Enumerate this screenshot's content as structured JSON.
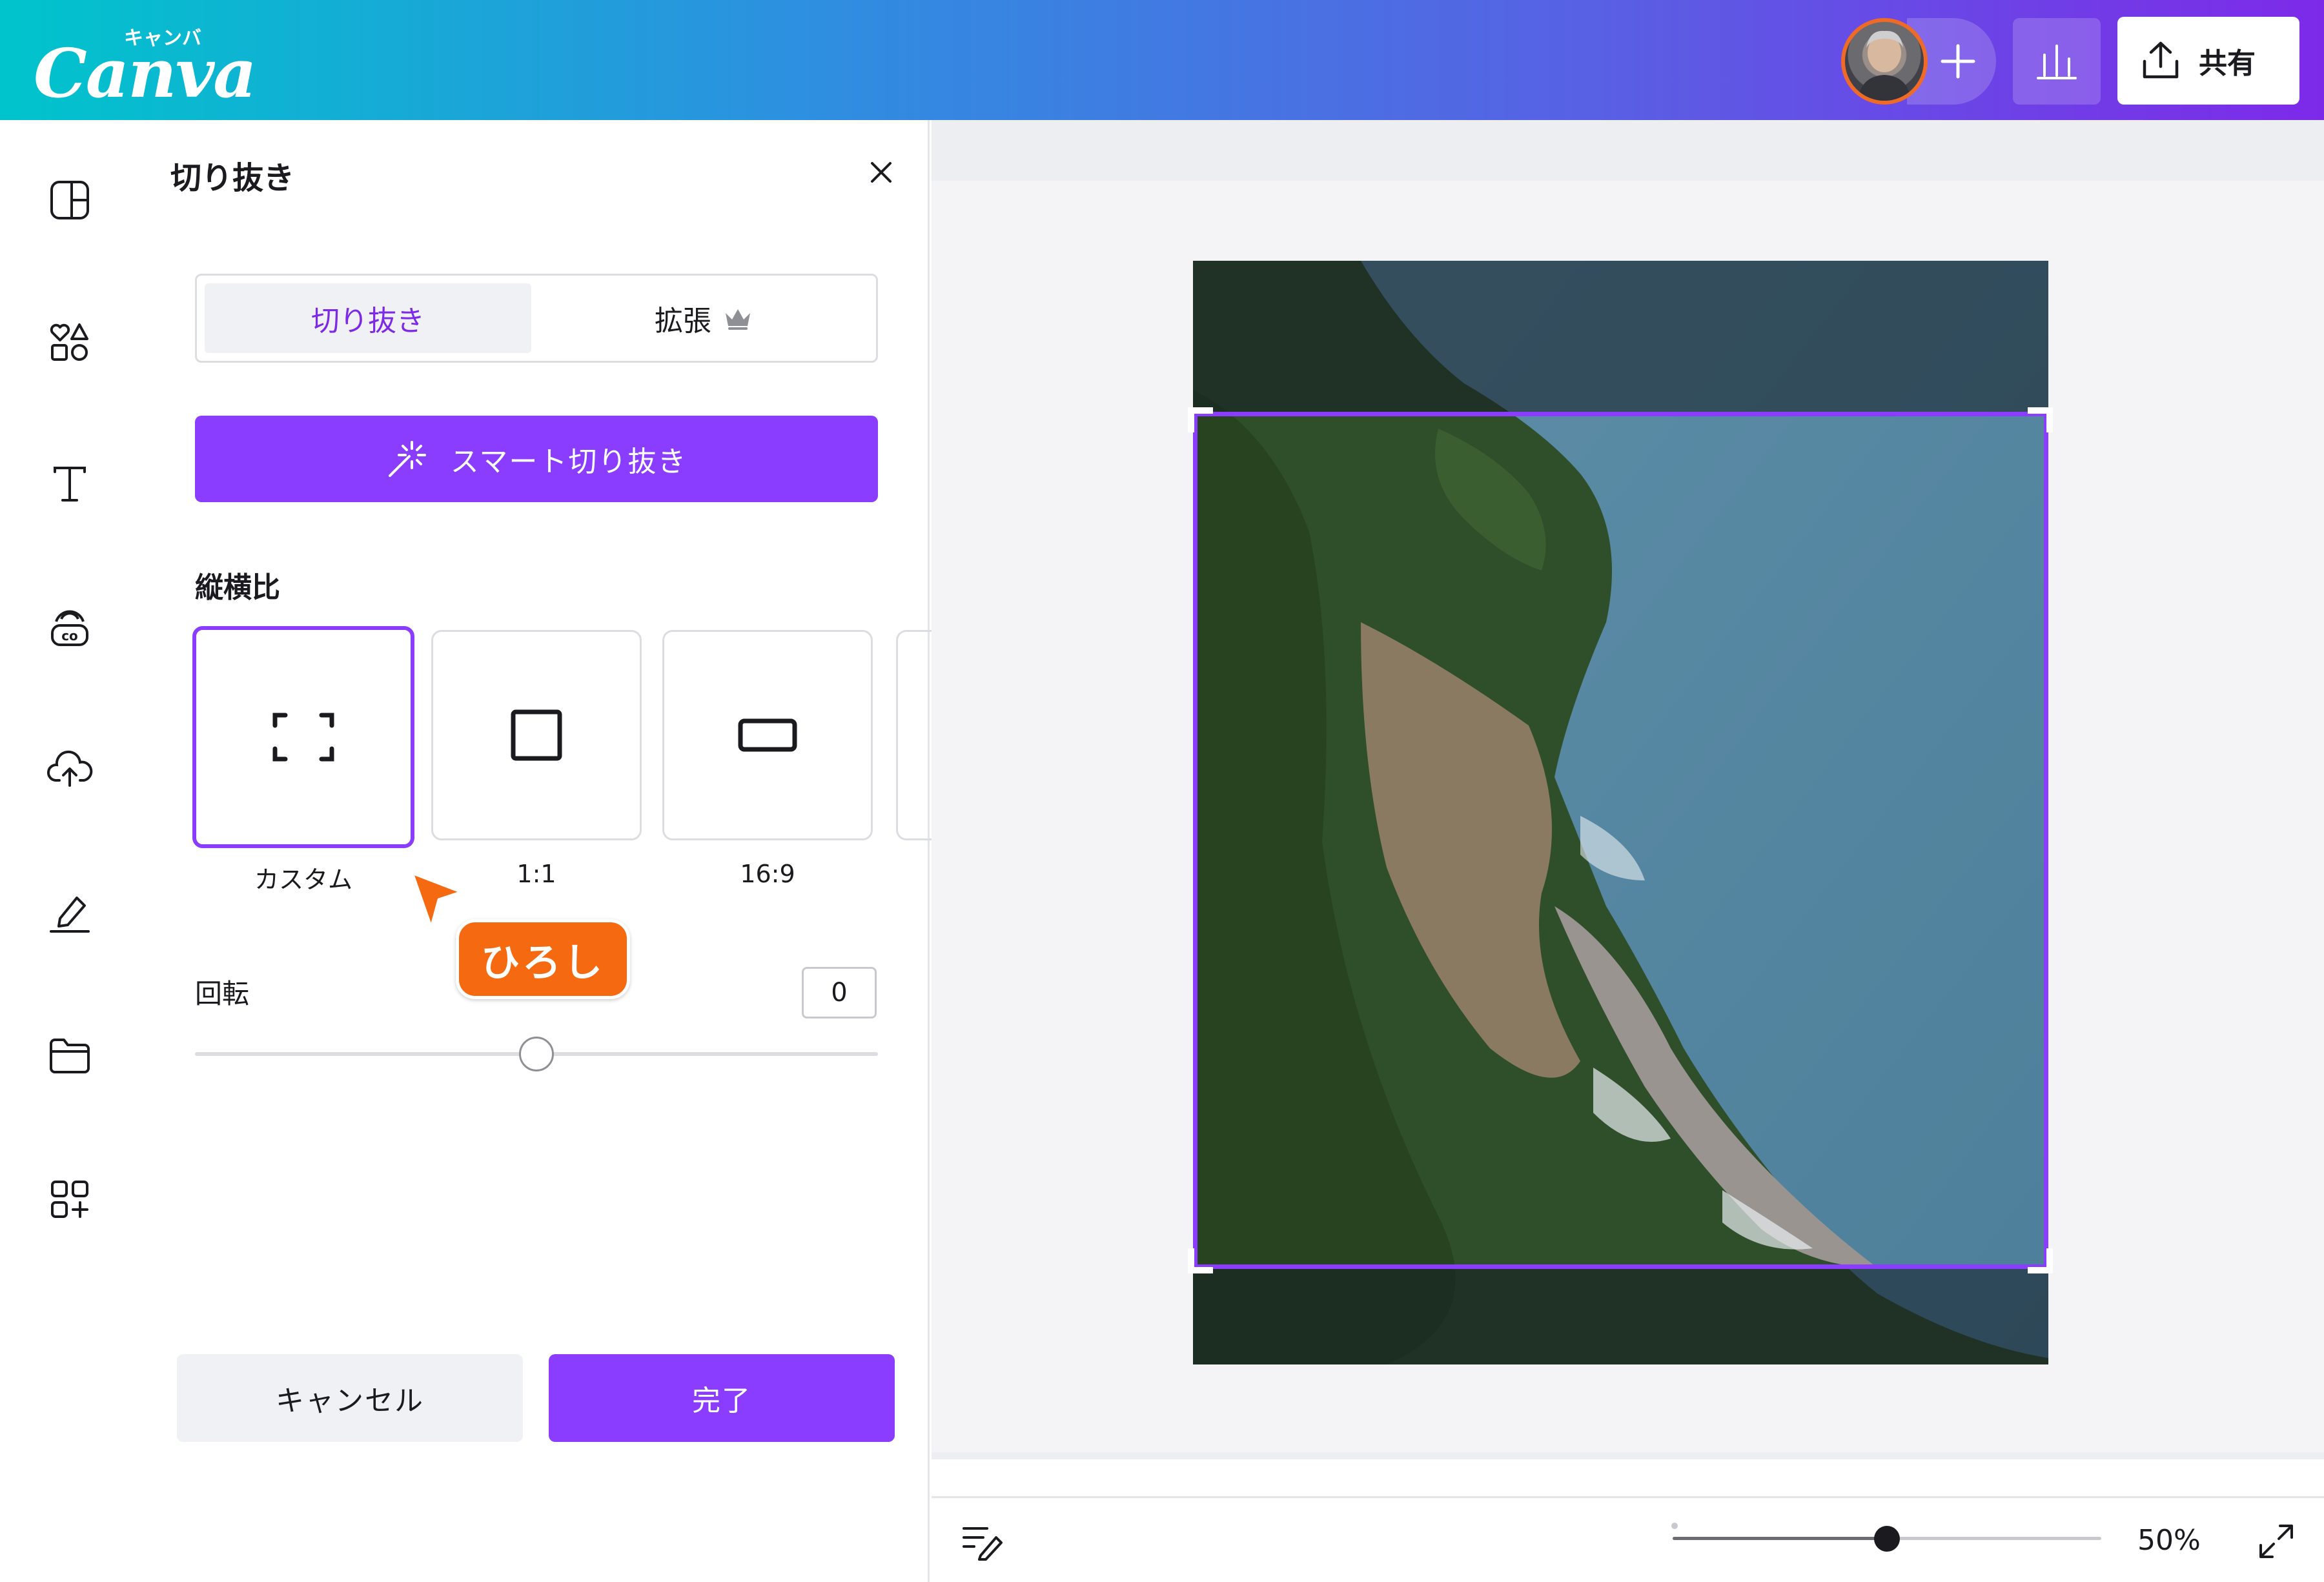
{
  "header": {
    "logo_kana": "キャンバ",
    "logo_word": "Canva",
    "share_label": "共有"
  },
  "panel": {
    "title": "切り抜き",
    "tabs": {
      "crop": "切り抜き",
      "expand": "拡張"
    },
    "smart_crop_label": "スマート切り抜き",
    "aspect_ratio_title": "縦横比",
    "ratios": [
      {
        "label": "カスタム",
        "selected": true
      },
      {
        "label": "1:1",
        "selected": false
      },
      {
        "label": "16:9",
        "selected": false
      }
    ],
    "rotation_label": "回転",
    "rotation_value": "0",
    "rotation_slider_fraction": 0.5,
    "cancel_label": "キャンセル",
    "done_label": "完了"
  },
  "collaborator": {
    "name": "ひろし",
    "color": "#f56a11"
  },
  "footer": {
    "zoom_label": "50%",
    "zoom_fraction": 0.5
  },
  "colors": {
    "accent": "#8b3dff",
    "header_start": "#00c4cc",
    "header_end": "#7d2ae8"
  }
}
